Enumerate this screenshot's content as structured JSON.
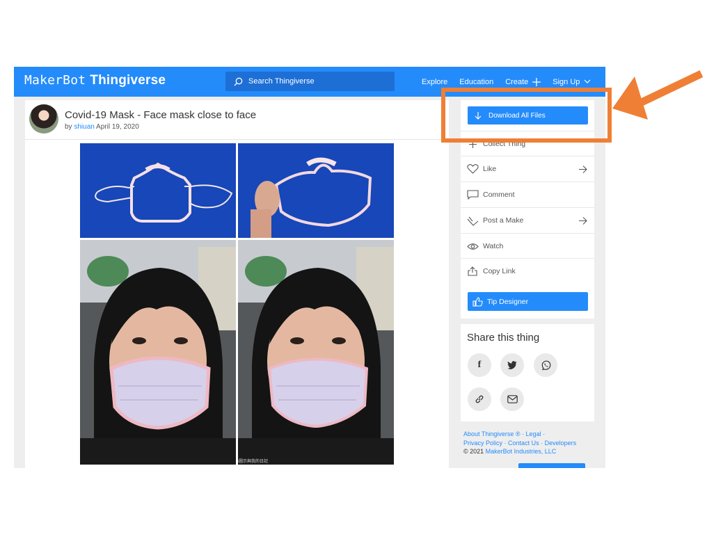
{
  "navbar": {
    "logo_prefix": "MakerBot",
    "logo_main": "Thingiverse",
    "search_placeholder": "Search Thingiverse",
    "links": [
      "Explore",
      "Education",
      "Create",
      "Sign Up"
    ]
  },
  "thing": {
    "title": "Covid-19 Mask - Face mask close to face",
    "by_label": "by",
    "author": "shiuan",
    "date": "April 19, 2020",
    "watermark": "http://mingshuan.blogspot.com/ 小圖示與我的日記"
  },
  "sidebar": {
    "download_label": "Download All Files",
    "items": [
      {
        "label": "Collect Thing",
        "icon": "plus-icon"
      },
      {
        "label": "Like",
        "icon": "heart-icon"
      },
      {
        "label": "Comment",
        "icon": "comment-icon"
      },
      {
        "label": "Post a Make",
        "icon": "make-icon"
      },
      {
        "label": "Watch",
        "icon": "eye-icon"
      },
      {
        "label": "Copy Link",
        "icon": "share-icon"
      }
    ],
    "tip_label": "Tip Designer"
  },
  "share": {
    "title": "Share this thing",
    "buttons": [
      "facebook-icon",
      "twitter-icon",
      "whatsapp-icon",
      "link-icon",
      "email-icon"
    ],
    "labels": {
      "facebook": "f"
    }
  },
  "footer": {
    "about": "About Thingiverse ®",
    "legal": "Legal",
    "privacy": "Privacy Policy",
    "contact": "Contact Us",
    "developers": "Developers",
    "copyright": "© 2021",
    "company": "MakerBot Industries, LLC",
    "sep": "·"
  },
  "colors": {
    "brand_blue": "#248bfb",
    "annotation_orange": "#ef7f35"
  }
}
